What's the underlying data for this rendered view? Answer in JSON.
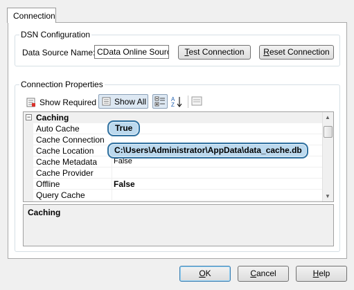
{
  "tabs": [
    {
      "label": "Connection"
    }
  ],
  "dsn_group": {
    "title": "DSN Configuration",
    "data_source_label": "Data Source Name:",
    "data_source_value": "CData Online Source",
    "test_button": {
      "mnemonic": "T",
      "rest": "est Connection"
    },
    "reset_button": {
      "mnemonic": "R",
      "rest": "eset Connection"
    }
  },
  "props_group": {
    "title": "Connection Properties",
    "show_required_label": "Show Required",
    "show_all_label": "Show All",
    "icons": {
      "show_required": "required-list-icon",
      "show_all": "list-icon",
      "categorized": "categorized-icon",
      "sort_az": "sort-az-icon",
      "property_pages": "property-pages-icon"
    }
  },
  "grid": {
    "category": {
      "label": "Caching",
      "expander": "−"
    },
    "rows": [
      {
        "name": "Auto Cache",
        "value": ""
      },
      {
        "name": "Cache Connection",
        "value": ""
      },
      {
        "name": "Cache Location",
        "value": ""
      },
      {
        "name": "Cache Metadata",
        "value": "False"
      },
      {
        "name": "Cache Provider",
        "value": ""
      },
      {
        "name": "Offline",
        "value": "False"
      },
      {
        "name": "Query Cache",
        "value": ""
      }
    ],
    "callouts": {
      "auto_cache": "True",
      "cache_location": "C:\\Users\\Administrator\\AppData\\data_cache.db"
    },
    "scroll": {
      "up": "▲",
      "down": "▼"
    }
  },
  "description": {
    "title": "Caching"
  },
  "footer": {
    "ok": {
      "mnemonic": "O",
      "rest": "K"
    },
    "cancel": {
      "mnemonic": "C",
      "rest": "ancel"
    },
    "help": {
      "mnemonic": "H",
      "rest": "elp"
    }
  }
}
